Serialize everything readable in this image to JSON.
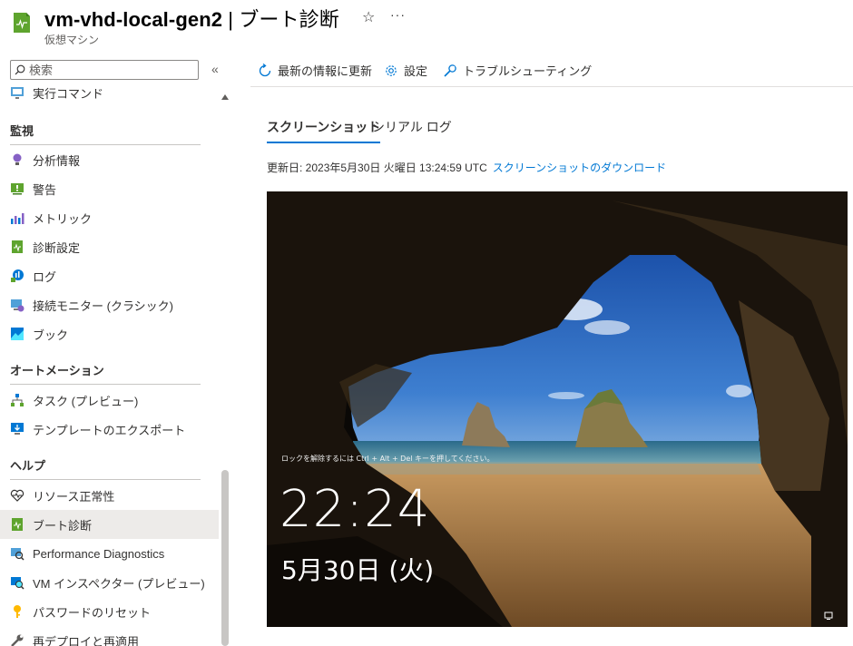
{
  "header": {
    "resource_name": "vm-vhd-local-gen2",
    "separator": " | ",
    "blade_title": "ブート診断",
    "subtitle": "仮想マシン",
    "star_icon": "☆",
    "more_icon": "···"
  },
  "sidebar": {
    "search_placeholder": "検索",
    "collapse_icon": "«",
    "items_top": [
      {
        "label": "実行コマンド",
        "icon": "run-command-icon"
      }
    ],
    "sections": [
      {
        "title": "監視",
        "items": [
          {
            "label": "分析情報",
            "icon": "insights-icon"
          },
          {
            "label": "警告",
            "icon": "alerts-icon"
          },
          {
            "label": "メトリック",
            "icon": "metrics-icon"
          },
          {
            "label": "診断設定",
            "icon": "diagnostic-settings-icon"
          },
          {
            "label": "ログ",
            "icon": "logs-icon"
          },
          {
            "label": "接続モニター (クラシック)",
            "icon": "connection-monitor-icon"
          },
          {
            "label": "ブック",
            "icon": "workbooks-icon"
          }
        ]
      },
      {
        "title": "オートメーション",
        "items": [
          {
            "label": "タスク (プレビュー)",
            "icon": "tasks-icon"
          },
          {
            "label": "テンプレートのエクスポート",
            "icon": "export-template-icon"
          }
        ]
      },
      {
        "title": "ヘルプ",
        "items": [
          {
            "label": "リソース正常性",
            "icon": "resource-health-icon"
          },
          {
            "label": "ブート診断",
            "icon": "boot-diagnostics-icon",
            "selected": true
          },
          {
            "label": "Performance Diagnostics",
            "icon": "performance-diagnostics-icon"
          },
          {
            "label": "VM インスペクター (プレビュー)",
            "icon": "vm-inspector-icon"
          },
          {
            "label": "パスワードのリセット",
            "icon": "reset-password-icon"
          },
          {
            "label": "再デプロイと再適用",
            "icon": "redeploy-icon"
          }
        ]
      }
    ]
  },
  "toolbar": {
    "refresh_label": "最新の情報に更新",
    "settings_label": "設定",
    "troubleshoot_label": "トラブルシューティング"
  },
  "tabs": {
    "screenshot": "スクリーンショット",
    "serial_log": "シリアル ログ"
  },
  "updated": {
    "text": "更新日: 2023年5月30日 火曜日 13:24:59 UTC",
    "download_link": "スクリーンショットのダウンロード"
  },
  "screenshot": {
    "lock_hint": "ロックを解除するには Ctrl + Alt + Del キーを押してください。",
    "time": "22:24",
    "date": "5月30日 (火)"
  },
  "colors": {
    "accent": "#0078d4",
    "selected_bg": "#edebe9",
    "vm_icon_green": "#5ea42e"
  }
}
